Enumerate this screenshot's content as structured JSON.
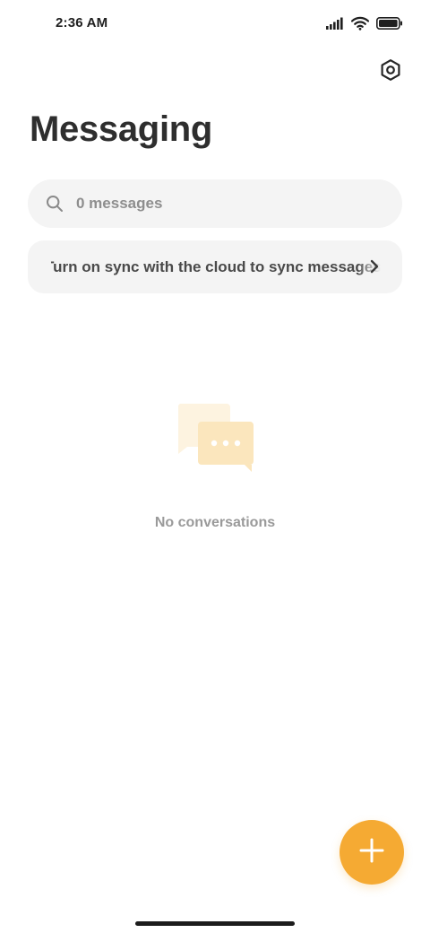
{
  "status_bar": {
    "time": "2:36 AM",
    "icons": [
      "cellular-signal-icon",
      "wifi-icon",
      "battery-icon"
    ]
  },
  "header": {
    "settings_icon": "settings-hexagon-icon",
    "title": "Messaging"
  },
  "search": {
    "placeholder": "0 messages",
    "value": "",
    "icon": "search-icon"
  },
  "sync_banner": {
    "text": "Turn on sync with the cloud to sync messages",
    "icon": "chevron-right-icon"
  },
  "empty_state": {
    "icon": "chat-bubbles-icon",
    "text": "No conversations"
  },
  "fab": {
    "icon": "plus-icon"
  },
  "colors": {
    "accent": "#f5aa33",
    "illustration_light": "#fdf3e0",
    "illustration_mid": "#fbe6bd",
    "surface": "#f4f4f4"
  }
}
